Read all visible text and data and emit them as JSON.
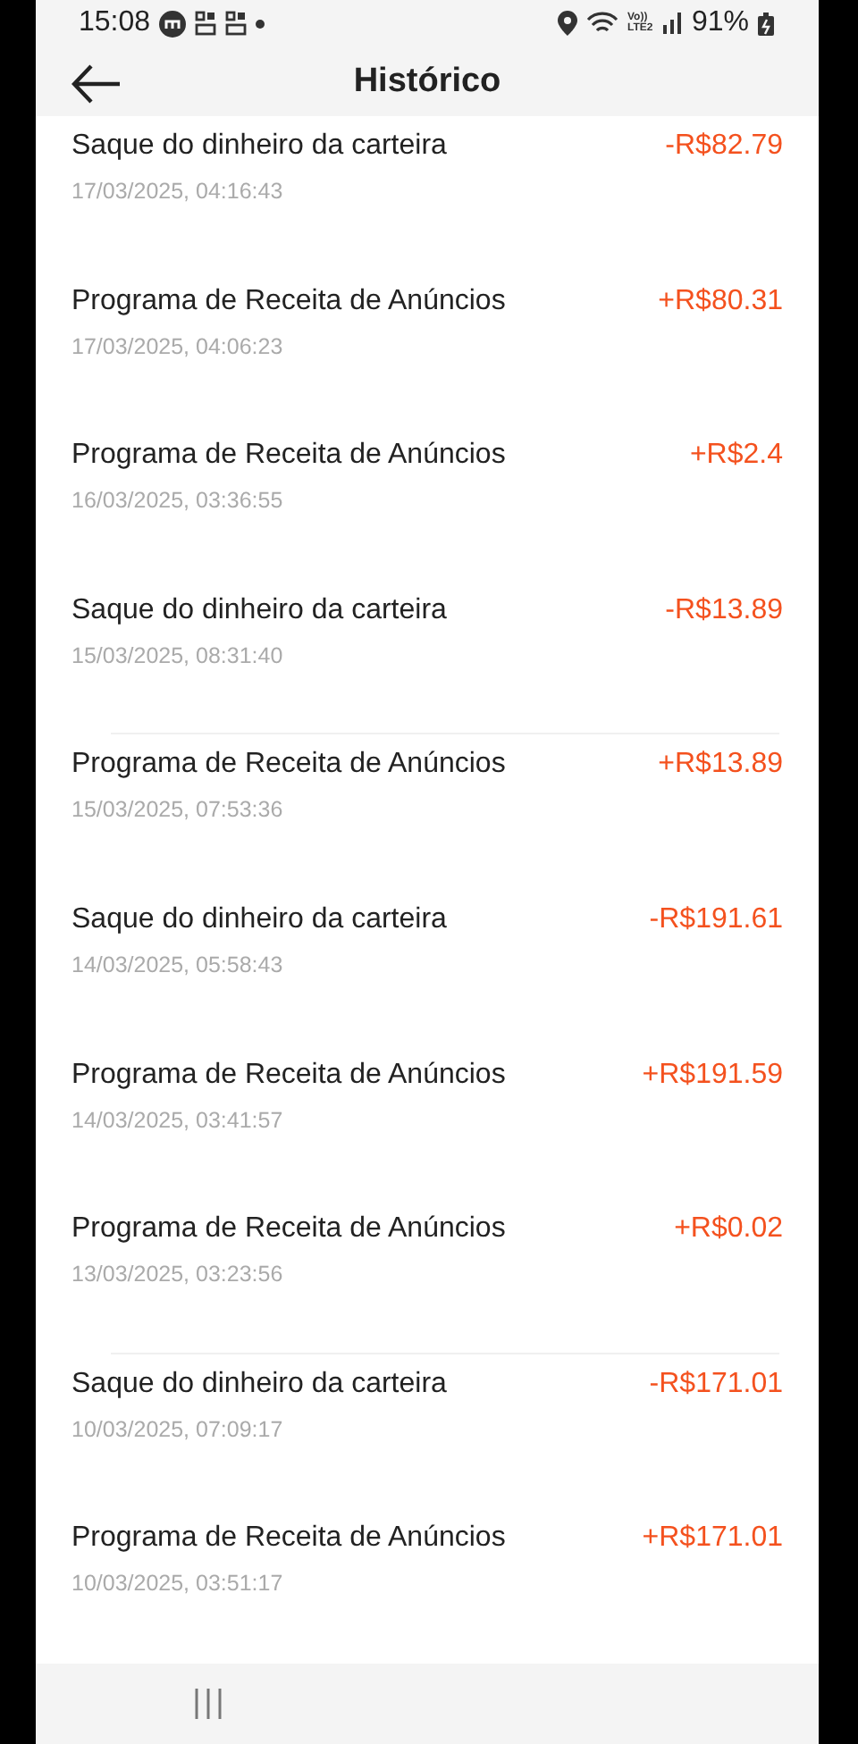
{
  "status_bar": {
    "time": "15:08",
    "network": "Vo)) LTE2",
    "battery": "91%"
  },
  "header": {
    "title": "Histórico"
  },
  "transactions": [
    {
      "title": "Saque do dinheiro da carteira",
      "date": "17/03/2025, 04:16:43",
      "amount": "-R$82.79",
      "divider": false
    },
    {
      "title": "Programa de Receita de Anúncios",
      "date": "17/03/2025, 04:06:23",
      "amount": "+R$80.31",
      "divider": false
    },
    {
      "title": "Programa de Receita de Anúncios",
      "date": "16/03/2025, 03:36:55",
      "amount": "+R$2.4",
      "divider": false
    },
    {
      "title": "Saque do dinheiro da carteira",
      "date": "15/03/2025, 08:31:40",
      "amount": "-R$13.89",
      "divider": true
    },
    {
      "title": "Programa de Receita de Anúncios",
      "date": "15/03/2025, 07:53:36",
      "amount": "+R$13.89",
      "divider": false
    },
    {
      "title": "Saque do dinheiro da carteira",
      "date": "14/03/2025, 05:58:43",
      "amount": "-R$191.61",
      "divider": false
    },
    {
      "title": "Programa de Receita de Anúncios",
      "date": "14/03/2025, 03:41:57",
      "amount": "+R$191.59",
      "divider": false
    },
    {
      "title": "Programa de Receita de Anúncios",
      "date": "13/03/2025, 03:23:56",
      "amount": "+R$0.02",
      "divider": true
    },
    {
      "title": "Saque do dinheiro da carteira",
      "date": "10/03/2025, 07:09:17",
      "amount": "-R$171.01",
      "divider": false
    },
    {
      "title": "Programa de Receita de Anúncios",
      "date": "10/03/2025, 03:51:17",
      "amount": "+R$171.01",
      "divider": false
    }
  ]
}
